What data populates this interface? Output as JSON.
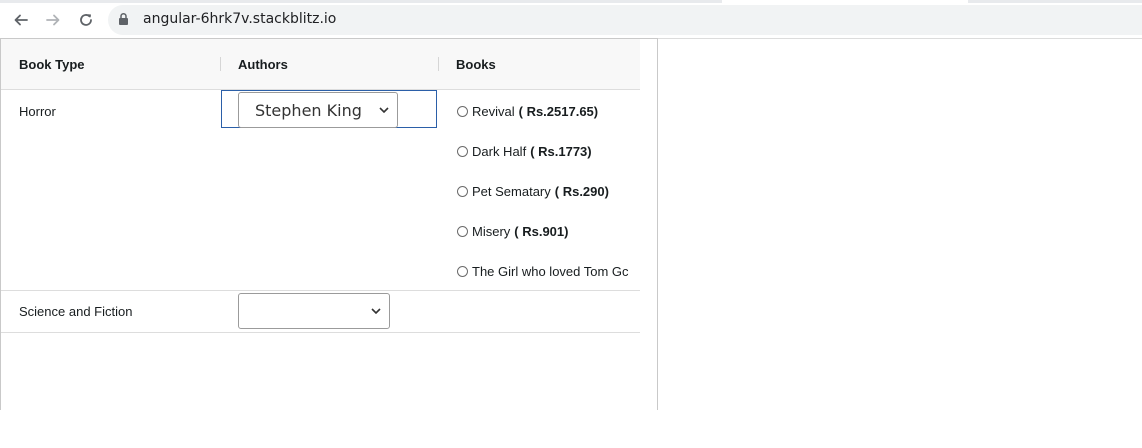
{
  "browser": {
    "url": "angular-6hrk7v.stackblitz.io"
  },
  "grid": {
    "columns": [
      "Book Type",
      "Authors",
      "Books"
    ],
    "rows": [
      {
        "book_type": "Horror",
        "author_selected": "Stephen King",
        "books": [
          {
            "title": "Revival",
            "price": "( Rs.2517.65)"
          },
          {
            "title": "Dark Half",
            "price": "( Rs.1773)"
          },
          {
            "title": "Pet Sematary",
            "price": "( Rs.290)"
          },
          {
            "title": "Misery",
            "price": "( Rs.901)"
          },
          {
            "title": "The Girl who loved Tom Gc",
            "price": ""
          }
        ]
      },
      {
        "book_type": "Science and Fiction",
        "author_selected": ""
      }
    ]
  },
  "colors": {
    "focus_border": "#2b5fa8",
    "header_bg": "#f8f8f8"
  }
}
